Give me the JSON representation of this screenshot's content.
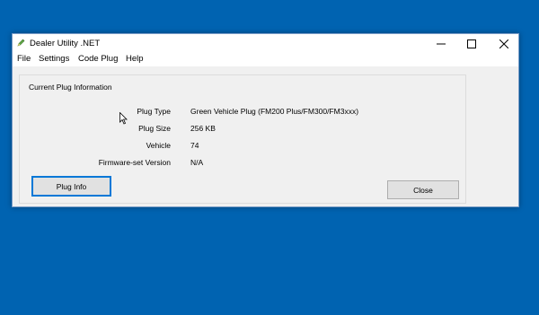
{
  "window": {
    "title": "Dealer Utility .NET",
    "icon": "pencil-icon"
  },
  "menu": {
    "file": "File",
    "settings": "Settings",
    "code_plug": "Code Plug",
    "help": "Help"
  },
  "group": {
    "title": "Current Plug Information"
  },
  "fields": [
    {
      "label": "Plug Type",
      "value": "Green Vehicle Plug (FM200 Plus/FM300/FM3xxx)"
    },
    {
      "label": "Plug Size",
      "value": "256 KB"
    },
    {
      "label": "Vehicle",
      "value": "74"
    },
    {
      "label": "Firmware-set Version",
      "value": "N/A"
    }
  ],
  "buttons": {
    "plug_info": "Plug Info",
    "close": "Close"
  },
  "colors": {
    "desktop": "#0063b1",
    "focus_border": "#0078d7"
  }
}
